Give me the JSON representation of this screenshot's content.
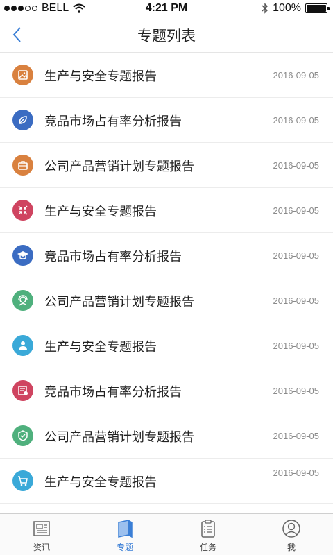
{
  "status_bar": {
    "carrier": "BELL",
    "time": "4:21 PM",
    "battery": "100%",
    "signal_dots_filled": 3,
    "signal_dots_total": 5
  },
  "nav": {
    "title": "专题列表",
    "back_icon": "chevron-left-icon"
  },
  "list": [
    {
      "title": "生产与安全专题报告",
      "date": "2016-09-05",
      "icon": "picture-icon",
      "color": "#d9813f"
    },
    {
      "title": "竞品市场占有率分析报告",
      "date": "2016-09-05",
      "icon": "leaf-icon",
      "color": "#3b6cc2"
    },
    {
      "title": "公司产品营销计划专题报告",
      "date": "2016-09-05",
      "icon": "briefcase-icon",
      "color": "#d9813f"
    },
    {
      "title": "生产与安全专题报告",
      "date": "2016-09-05",
      "icon": "compress-icon",
      "color": "#cf4460"
    },
    {
      "title": "竞品市场占有率分析报告",
      "date": "2016-09-05",
      "icon": "graduation-cap-icon",
      "color": "#3b6cc2"
    },
    {
      "title": "公司产品营销计划专题报告",
      "date": "2016-09-05",
      "icon": "headset-icon",
      "color": "#4fb07d"
    },
    {
      "title": "生产与安全专题报告",
      "date": "2016-09-05",
      "icon": "user-icon",
      "color": "#3aa9d8"
    },
    {
      "title": "竞品市场占有率分析报告",
      "date": "2016-09-05",
      "icon": "certificate-icon",
      "color": "#cf4460"
    },
    {
      "title": "公司产品营销计划专题报告",
      "date": "2016-09-05",
      "icon": "badge-icon",
      "color": "#4fb07d"
    },
    {
      "title": "生产与安全专题报告",
      "date": "2016-09-05",
      "icon": "cart-icon",
      "color": "#3aa9d8"
    }
  ],
  "tabs": [
    {
      "label": "资讯",
      "icon": "news-icon",
      "active": false
    },
    {
      "label": "专题",
      "icon": "book-icon",
      "active": true
    },
    {
      "label": "任务",
      "icon": "clipboard-icon",
      "active": false
    },
    {
      "label": "我",
      "icon": "profile-icon",
      "active": false
    }
  ],
  "colors": {
    "accent": "#3b7fd6",
    "text": "#222222",
    "date": "#8a8a8a"
  }
}
